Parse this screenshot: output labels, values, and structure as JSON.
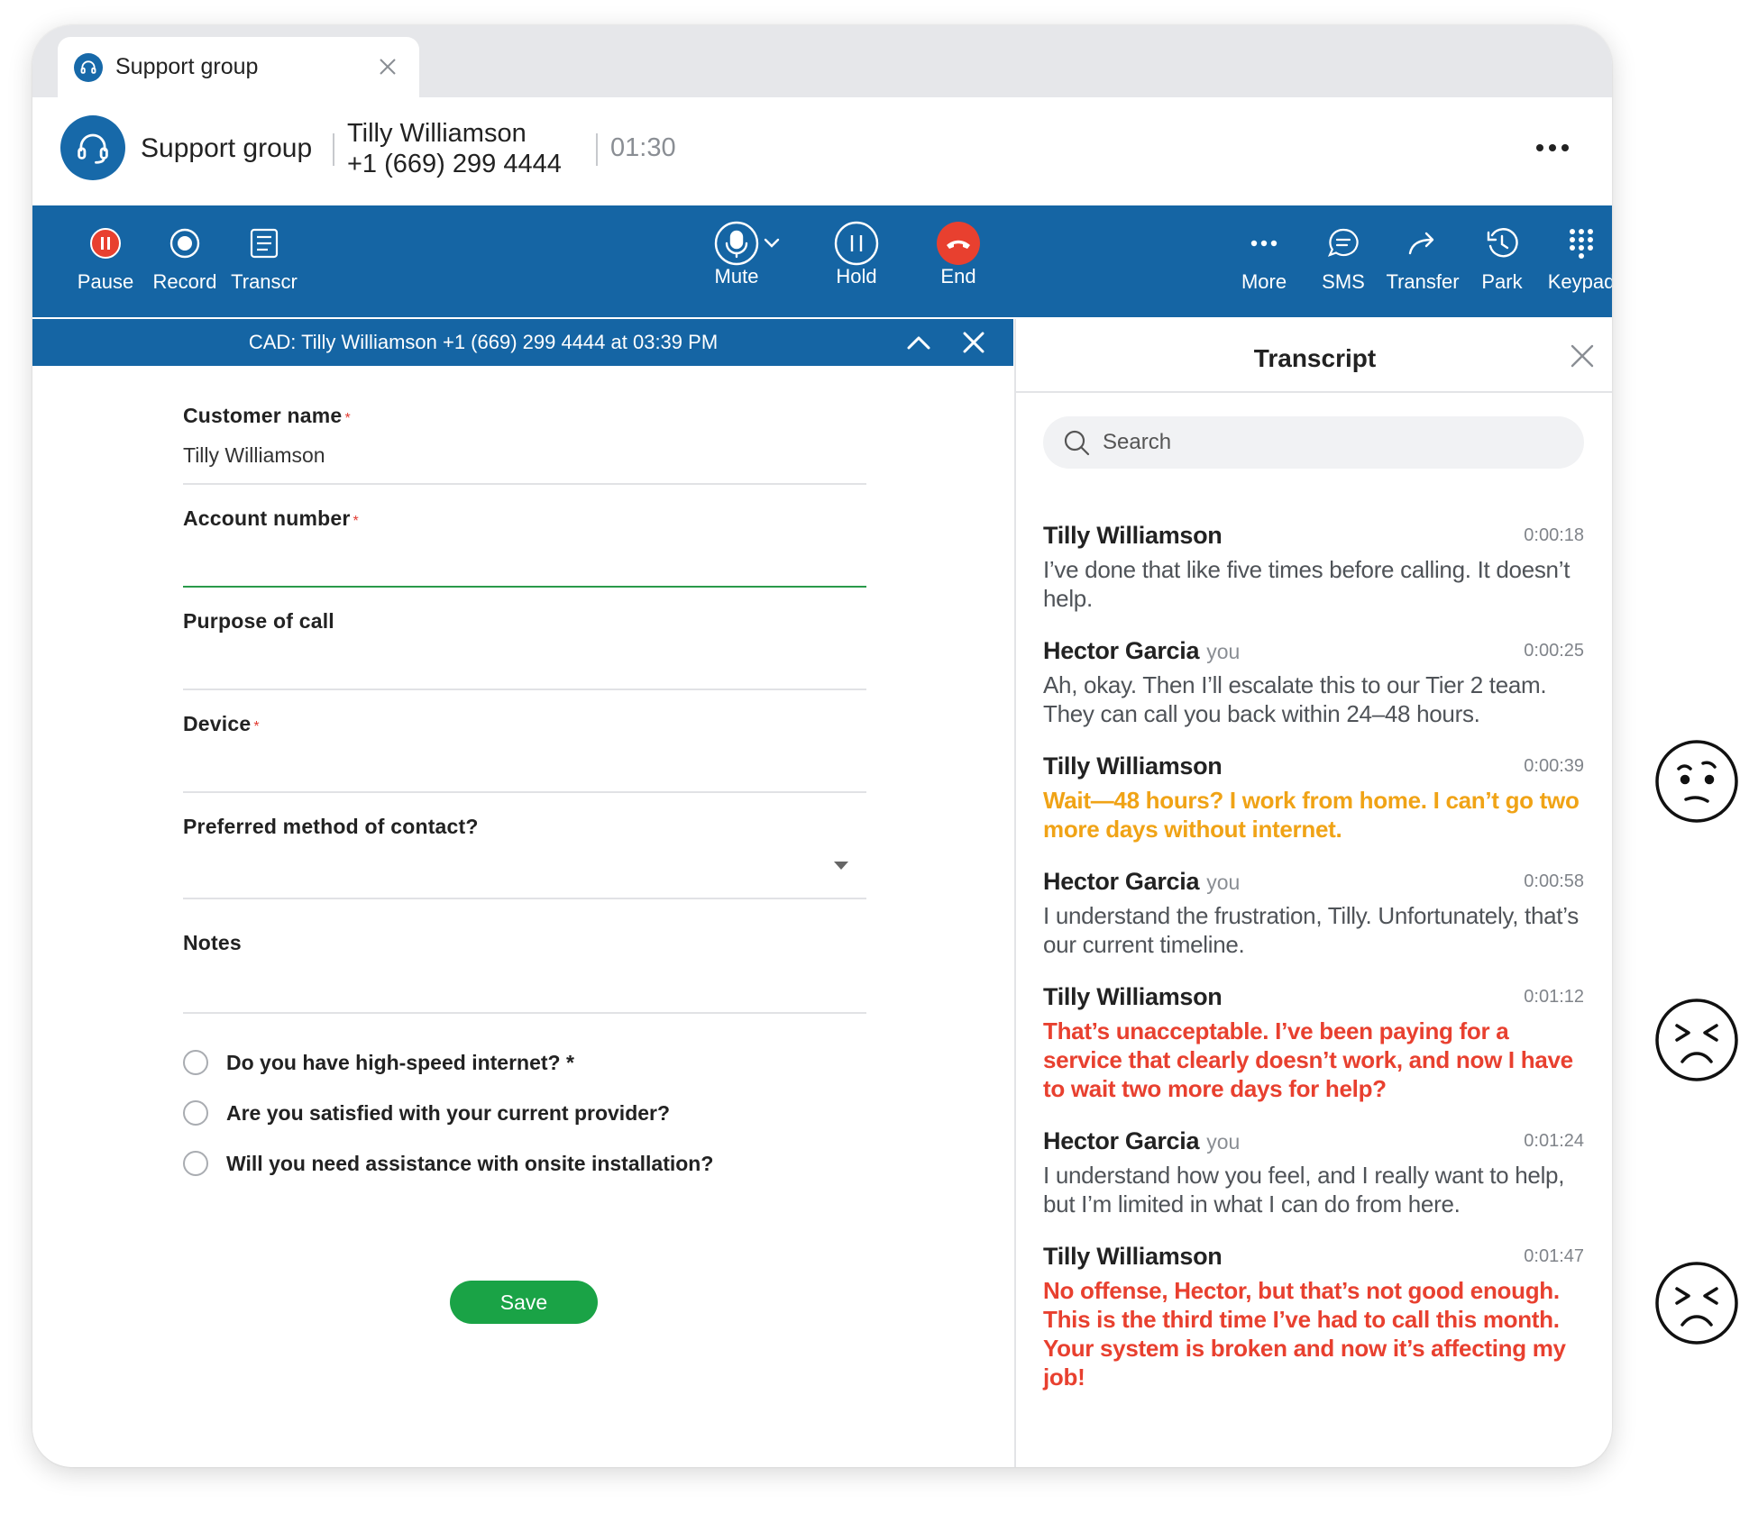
{
  "tab": {
    "title": "Support group"
  },
  "header": {
    "group": "Support group",
    "caller_name": "Tilly Williamson",
    "caller_phone": "+1 (669) 299 4444",
    "timer": "01:30"
  },
  "toolbar": {
    "pause": "Pause",
    "record": "Record",
    "transcr": "Transcr",
    "mute": "Mute",
    "hold": "Hold",
    "end": "End",
    "more": "More",
    "sms": "SMS",
    "transfer": "Transfer",
    "park": "Park",
    "keypad": "Keypad"
  },
  "cad": {
    "title": "CAD: Tilly Williamson +1 (669) 299 4444 at 03:39 PM"
  },
  "form": {
    "customer_name_label": "Customer name",
    "customer_name_value": "Tilly Williamson",
    "account_number_label": "Account number",
    "purpose_label": "Purpose of call",
    "device_label": "Device",
    "contact_label": "Preferred method of contact?",
    "notes_label": "Notes",
    "required_mark": "*",
    "questions": [
      "Do you have high-speed internet? *",
      "Are you satisfied with your current provider?",
      "Will you need assistance with onsite installation?"
    ],
    "save_label": "Save"
  },
  "transcript": {
    "title": "Transcript",
    "search_placeholder": "Search",
    "you_tag": "you",
    "messages": [
      {
        "speaker": "Tilly Williamson",
        "time": "0:00:18",
        "text": "I’ve done that like five times before calling. It doesn’t help.",
        "tone": "neutral"
      },
      {
        "speaker": "Hector Garcia",
        "time": "0:00:25",
        "text": "Ah, okay. Then I’ll escalate this to our Tier 2 team. They can call you back within 24–48 hours.",
        "tone": "neutral"
      },
      {
        "speaker": "Tilly Williamson",
        "time": "0:00:39",
        "text": "Wait—48 hours? I work from home. I can’t go two more days without internet.",
        "tone": "concerned"
      },
      {
        "speaker": "Hector Garcia",
        "time": "0:00:58",
        "text": "I understand the frustration, Tilly. Unfortunately, that’s our current timeline.",
        "tone": "neutral"
      },
      {
        "speaker": "Tilly Williamson",
        "time": "0:01:12",
        "text": "That’s unacceptable. I’ve been paying for a service that clearly doesn’t work, and now I have to wait two more days for help?",
        "tone": "angry"
      },
      {
        "speaker": "Hector Garcia",
        "time": "0:01:24",
        "text": "I understand how you feel, and I really want to help, but I’m limited in what I can do from here.",
        "tone": "neutral"
      },
      {
        "speaker": "Tilly Williamson",
        "time": "0:01:47",
        "text": "No offense, Hector, but that’s not good enough. This is the third time I’ve had to call this month. Your system is broken and now it’s affecting my job!",
        "tone": "angry"
      }
    ]
  },
  "sentiment_icons": [
    "confused-face-icon",
    "angry-face-icon",
    "angry-face-icon"
  ],
  "colors": {
    "brand_blue": "#1565a4",
    "end_red": "#e8402f",
    "warn_orange": "#f0a316",
    "angry_red": "#e8402f",
    "save_green": "#1aa346"
  }
}
